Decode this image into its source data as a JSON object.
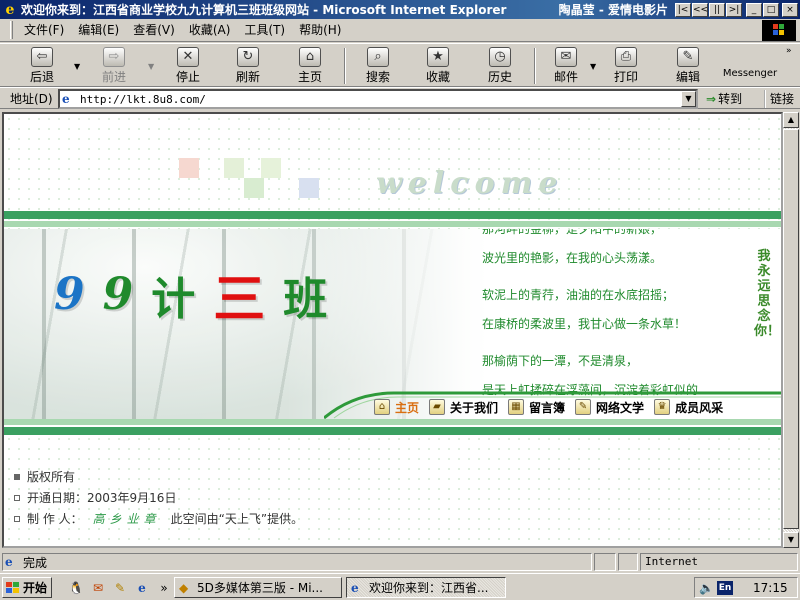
{
  "window": {
    "title": "欢迎你来到：江西省商业学校九九计算机三班班级网站 - Microsoft Internet Explorer",
    "title_extra": "陶晶莹 - 爱情电影片",
    "controls": {
      "prev": "|<",
      "back": "<<",
      "play": "||",
      "next": ">|",
      "minimize": "_",
      "restore": "□",
      "close": "×"
    }
  },
  "menu": {
    "items": [
      "文件(F)",
      "编辑(E)",
      "查看(V)",
      "收藏(A)",
      "工具(T)",
      "帮助(H)"
    ]
  },
  "toolbar": {
    "back": "后退",
    "forward": "前进",
    "stop": "停止",
    "refresh": "刷新",
    "home": "主页",
    "search": "搜索",
    "favorites": "收藏",
    "history": "历史",
    "mail": "邮件",
    "print": "打印",
    "edit": "编辑",
    "messenger": "Messenger"
  },
  "address": {
    "label": "地址(D)",
    "url": "http://lkt.8u8.com/",
    "go_label": "转到",
    "links_label": "链接"
  },
  "page": {
    "welcome": "welcome",
    "class_name": {
      "c1": "9",
      "c2": "9",
      "c3": "计",
      "c4": "三",
      "c5": "班"
    },
    "poem": [
      "那河畔的金柳，是夕阳中的新娘，",
      "波光里的艳影，在我的心头荡漾。",
      "软泥上的青荇，油油的在水底招摇；",
      "在康桥的柔波里，我甘心做一条水草！",
      "那榆荫下的一潭，不是清泉，",
      "是天上虹揉碎在浮藻间，沉淀着彩虹似的"
    ],
    "vertical_text": "我永远思念你！",
    "nav": {
      "home": "主页",
      "about": "关于我们",
      "guestbook": "留言簿",
      "literature": "网络文学",
      "members": "成员风采"
    },
    "footer": {
      "copyright": "版权所有",
      "open_date": "开通日期：2003年9月16日",
      "maker_label": "制 作 人：",
      "maker_sign": "高乡业章",
      "host_note": "此空间由“天上飞”提供。"
    },
    "accent_green": "#1f8a2c",
    "accent_red": "#e01010",
    "accent_blue": "#1b74c6"
  },
  "status": {
    "text": "完成",
    "zone": "Internet"
  },
  "taskbar": {
    "start": "开始",
    "tasks": [
      "5D多媒体第三版 - Mi...",
      "欢迎你来到：江西省..."
    ],
    "clock": "17:15",
    "lang": "En",
    "quick_icons": [
      "qq-icon",
      "outlook-icon",
      "pen-icon",
      "ie-icon"
    ],
    "more": "»"
  }
}
